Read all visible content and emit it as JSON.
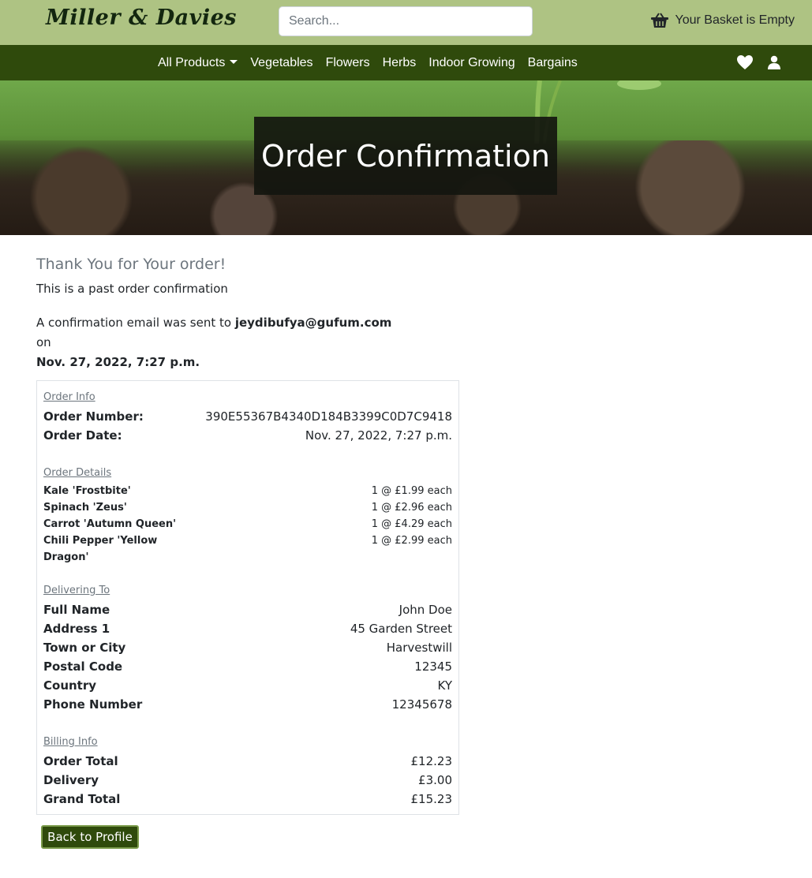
{
  "header": {
    "brand": "Miller & Davies",
    "search_placeholder": "Search...",
    "basket_text": "Your Basket is Empty"
  },
  "nav": {
    "items": [
      "All Products",
      "Vegetables",
      "Flowers",
      "Herbs",
      "Indoor Growing",
      "Bargains"
    ]
  },
  "hero": {
    "title": "Order Confirmation"
  },
  "main": {
    "thanks": "Thank You for Your order!",
    "past_note": "This is a past order confirmation",
    "email_prefix": "A confirmation email was sent to",
    "email": "jeydibufya@gufum.com",
    "email_on": "on",
    "email_date": "Nov. 27, 2022, 7:27 p.m."
  },
  "order_info": {
    "title": "Order Info",
    "number_label": "Order Number:",
    "number": "390E55367B4340D184B3399C0D7C9418",
    "date_label": "Order Date:",
    "date": "Nov. 27, 2022, 7:27 p.m."
  },
  "order_details": {
    "title": "Order Details",
    "items": [
      {
        "name": "Kale 'Frostbite'",
        "qty": "1 @ £1.99 each"
      },
      {
        "name": "Spinach 'Zeus'",
        "qty": "1 @ £2.96 each"
      },
      {
        "name": "Carrot 'Autumn Queen'",
        "qty": "1 @ £4.29 each"
      },
      {
        "name": "Chili Pepper 'Yellow Dragon'",
        "qty": "1 @ £2.99 each"
      }
    ]
  },
  "delivering_to": {
    "title": "Delivering To",
    "rows": [
      {
        "label": "Full Name",
        "value": "John Doe"
      },
      {
        "label": "Address 1",
        "value": "45 Garden Street"
      },
      {
        "label": "Town or City",
        "value": "Harvestwill"
      },
      {
        "label": "Postal Code",
        "value": "12345"
      },
      {
        "label": "Country",
        "value": "KY"
      },
      {
        "label": "Phone Number",
        "value": "12345678"
      }
    ]
  },
  "billing": {
    "title": "Billing Info",
    "rows": [
      {
        "label": "Order Total",
        "value": "£12.23"
      },
      {
        "label": "Delivery",
        "value": "£3.00"
      },
      {
        "label": "Grand Total",
        "value": "£15.23"
      }
    ]
  },
  "back_button": "Back to Profile",
  "colors": {
    "header_bg": "#aec383",
    "nav_bg": "#2f4a0c",
    "button_bg": "#2f4a0c"
  }
}
